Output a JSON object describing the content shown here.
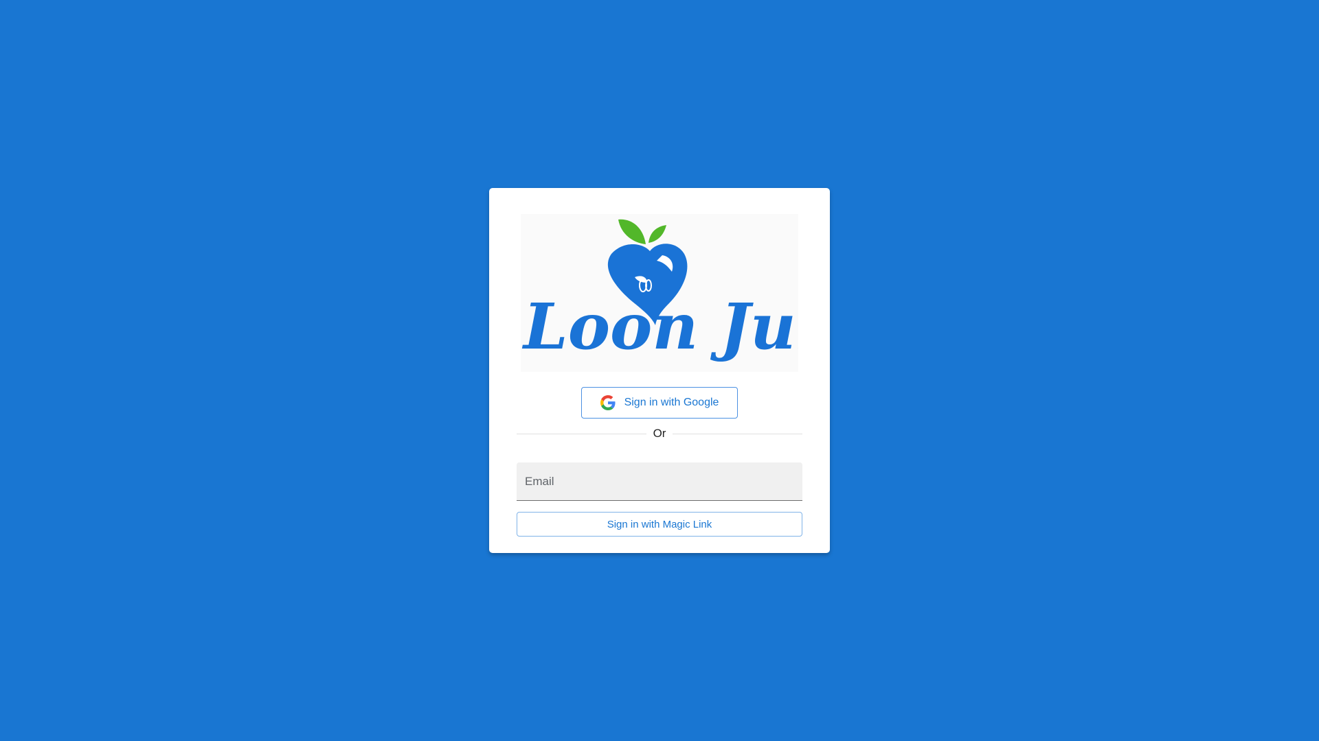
{
  "colors": {
    "background": "#1976d2",
    "card": "#ffffff",
    "accent": "#1976d2",
    "logo_blue": "#1a73d6",
    "logo_leaf": "#52b72a"
  },
  "logo": {
    "text": "Loon Juice",
    "icon": "apple-logo-icon"
  },
  "google_button": {
    "label": "Sign in with Google",
    "icon": "google-g-icon"
  },
  "divider": {
    "text": "Or"
  },
  "email": {
    "placeholder": "Email",
    "value": ""
  },
  "magic_link_button": {
    "label": "Sign in with Magic Link"
  }
}
